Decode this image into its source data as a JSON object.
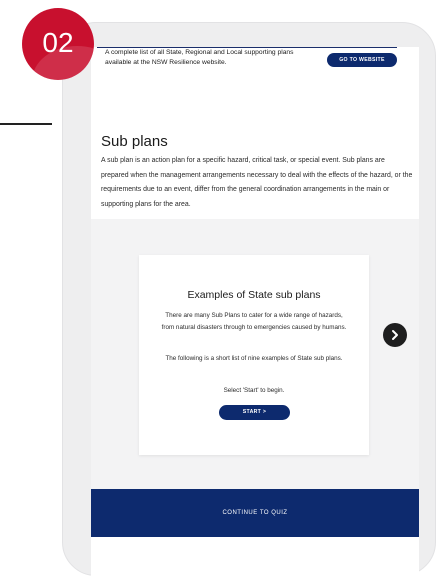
{
  "badge": {
    "number": "02"
  },
  "intro": {
    "text": "A complete list of all State, Regional and Local supporting plans available at the NSW Resilience website.",
    "go_button": "GO TO WEBSITE"
  },
  "sub_plans": {
    "title": "Sub plans",
    "paragraph": "A sub plan is an action plan for a specific hazard, critical task, or special event. Sub plans are prepared when the management arrangements necessary to deal with the effects of the hazard, or the requirements due to an event, differ from the general coordination arrangements in the main or supporting plans for the area."
  },
  "card": {
    "title": "Examples of State sub plans",
    "paragraph1": "There are many Sub Plans to cater for a wide range of hazards, from natural disasters through to emergencies caused by humans.",
    "paragraph2": "The following is a short list of nine examples of State sub plans.",
    "paragraph3": "Select 'Start' to begin.",
    "start_label": "START >"
  },
  "carousel": {
    "next_icon": "chevron-right-icon"
  },
  "quiz": {
    "label": "CONTINUE TO QUIZ"
  },
  "colors": {
    "brand_navy": "#0d2a6e",
    "badge_red": "#c8102e"
  }
}
